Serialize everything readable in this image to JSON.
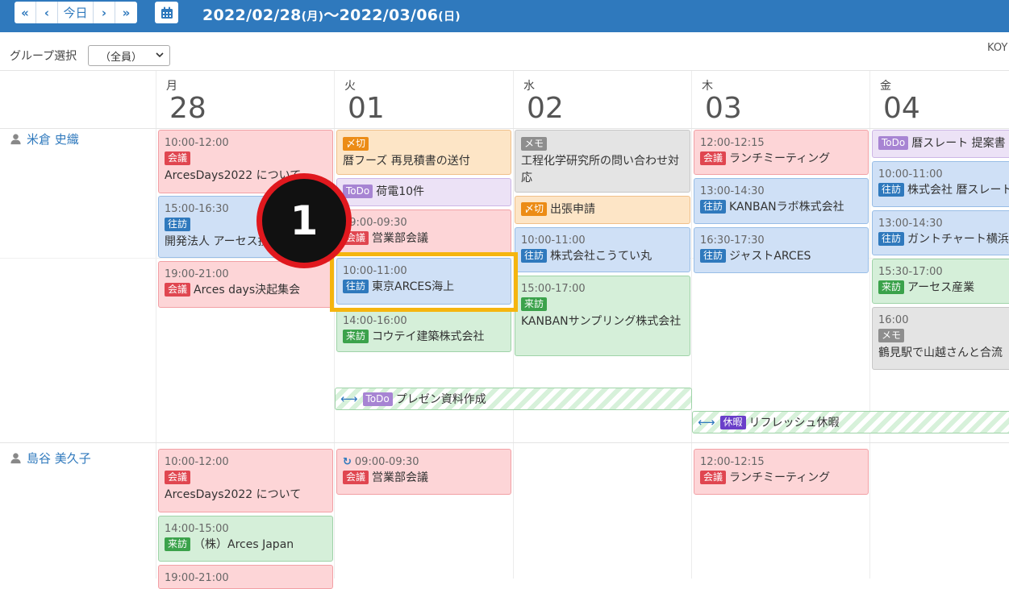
{
  "toolbar": {
    "prev_week": "«",
    "prev_day": "‹",
    "today": "今日",
    "next_day": "›",
    "next_week": "»",
    "date_start": "2022/02/28",
    "date_start_dow": "(月)",
    "date_sep": "～",
    "date_end": "2022/03/06",
    "date_end_dow": "(日)"
  },
  "filter": {
    "label": "グループ選択",
    "selected": "（全員）",
    "user_code": "KOY"
  },
  "days": [
    {
      "dow": "月",
      "num": "28"
    },
    {
      "dow": "火",
      "num": "01"
    },
    {
      "dow": "水",
      "num": "02"
    },
    {
      "dow": "木",
      "num": "03"
    },
    {
      "dow": "金",
      "num": "04"
    }
  ],
  "users": [
    {
      "name": "米倉 史織"
    },
    {
      "name": "島谷 美久子"
    }
  ],
  "events": {
    "u1_mon_1": {
      "time": "10:00-12:00",
      "tag": "会議",
      "title": "ArcesDays2022 について"
    },
    "u1_mon_2": {
      "time": "15:00-16:30",
      "tag": "往訪",
      "title": "開発法人 アーセス技研"
    },
    "u1_mon_3": {
      "time": "19:00-21:00",
      "tag": "会議",
      "title": "Arces days決起集会"
    },
    "u1_tue_1": {
      "tag": "〆切",
      "title": "暦フーズ 再見積書の送付"
    },
    "u1_tue_2": {
      "tag": "ToDo",
      "title": "荷電10件"
    },
    "u1_tue_3": {
      "time": "09:00-09:30",
      "tag": "会議",
      "title": "営業部会議"
    },
    "u1_tue_4": {
      "time": "10:00-11:00",
      "tag": "往訪",
      "title": "東京ARCES海上"
    },
    "u1_tue_5": {
      "time": "14:00-16:00",
      "tag": "来訪",
      "title": "コウテイ建築株式会社"
    },
    "u1_wed_1": {
      "tag": "メモ",
      "title": "工程化学研究所の問い合わせ対応"
    },
    "u1_wed_2": {
      "tag": "〆切",
      "title": "出張申請"
    },
    "u1_wed_3": {
      "time": "10:00-11:00",
      "tag": "往訪",
      "title": "株式会社こうてい丸"
    },
    "u1_wed_4": {
      "time": "15:00-17:00",
      "tag": "来訪",
      "title": "KANBANサンプリング株式会社"
    },
    "u1_thu_1": {
      "time": "12:00-12:15",
      "tag": "会議",
      "title": "ランチミーティング"
    },
    "u1_thu_2": {
      "time": "13:00-14:30",
      "tag": "往訪",
      "title": "KANBANラボ株式会社"
    },
    "u1_thu_3": {
      "time": "16:30-17:30",
      "tag": "往訪",
      "title": "ジャストARCES"
    },
    "u1_fri_1": {
      "tag": "ToDo",
      "title": "暦スレート 提案書"
    },
    "u1_fri_2": {
      "time": "10:00-11:00",
      "tag": "往訪",
      "title": "株式会社 暦スレート"
    },
    "u1_fri_3": {
      "time": "13:00-14:30",
      "tag": "往訪",
      "title": "ガントチャート横浜"
    },
    "u1_fri_4": {
      "time": "15:30-17:00",
      "tag": "来訪",
      "title": "アーセス産業"
    },
    "u1_fri_5": {
      "time": "16:00",
      "tag": "メモ",
      "title": "鶴見駅で山越さんと合流"
    },
    "bar_1": {
      "tag": "ToDo",
      "title": "プレゼン資料作成"
    },
    "bar_2": {
      "tag": "休暇",
      "title": "リフレッシュ休暇"
    },
    "u2_mon_1": {
      "time": "10:00-12:00",
      "tag": "会議",
      "title": "ArcesDays2022 について"
    },
    "u2_mon_2": {
      "time": "14:00-15:00",
      "tag": "来訪",
      "title": "（株）Arces Japan"
    },
    "u2_mon_3": {
      "time": "19:00-21:00"
    },
    "u2_tue_1": {
      "time": "09:00-09:30",
      "tag": "会議",
      "title": "営業部会議"
    },
    "u2_thu_1": {
      "time": "12:00-12:15",
      "tag": "会議",
      "title": "ランチミーティング"
    }
  },
  "callout": {
    "number": "1"
  }
}
